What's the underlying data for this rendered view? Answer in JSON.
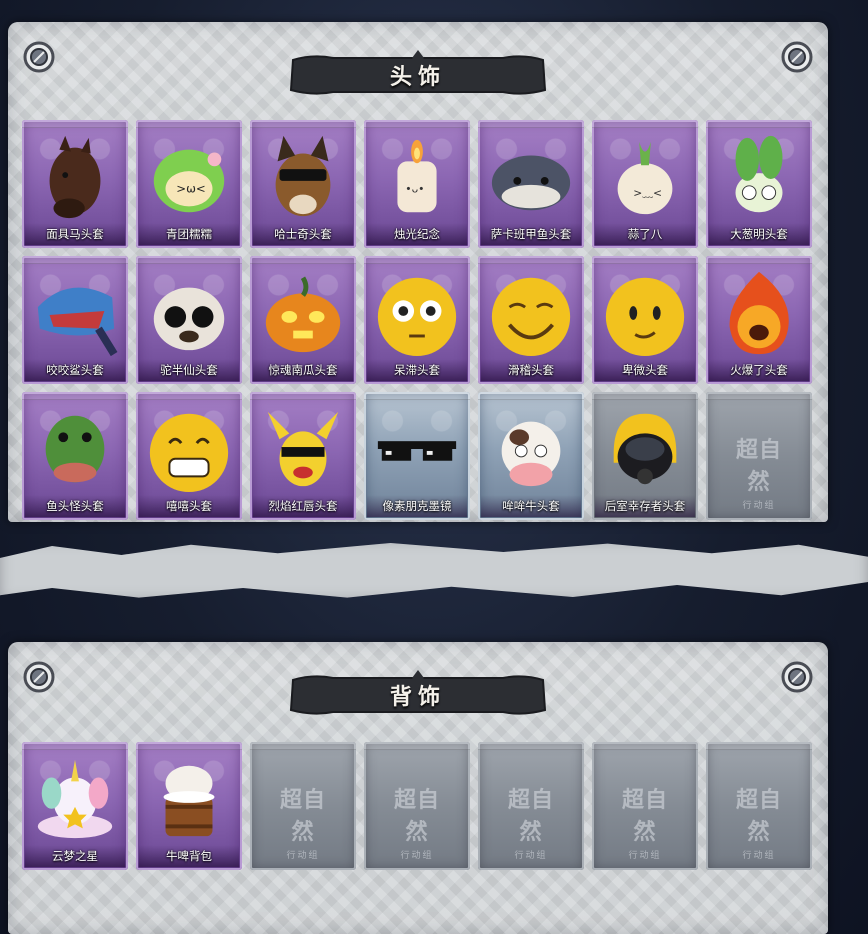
{
  "sections": [
    {
      "title": "头饰",
      "items": [
        {
          "label": "面具马头套",
          "rarity": "purple",
          "icon": "horse-mask-icon"
        },
        {
          "label": "青团糯糯",
          "rarity": "purple",
          "icon": "green-rice-ball-icon"
        },
        {
          "label": "哈士奇头套",
          "rarity": "purple",
          "icon": "husky-sunglasses-icon"
        },
        {
          "label": "烛光纪念",
          "rarity": "purple",
          "icon": "candle-head-icon"
        },
        {
          "label": "萨卡班甲鱼头套",
          "rarity": "purple",
          "icon": "sacabambaspis-fish-icon"
        },
        {
          "label": "蒜了八",
          "rarity": "purple",
          "icon": "garlic-head-icon"
        },
        {
          "label": "大葱明头套",
          "rarity": "purple",
          "icon": "scallion-head-icon"
        },
        {
          "label": "咬咬鲨头套",
          "rarity": "purple",
          "icon": "shark-head-icon"
        },
        {
          "label": "驼半仙头套",
          "rarity": "purple",
          "icon": "alpaca-sunglasses-icon"
        },
        {
          "label": "惊魂南瓜头套",
          "rarity": "purple",
          "icon": "pumpkin-head-icon"
        },
        {
          "label": "呆滞头套",
          "rarity": "purple",
          "icon": "dazed-emoji-icon"
        },
        {
          "label": "滑稽头套",
          "rarity": "purple",
          "icon": "funny-emoji-icon"
        },
        {
          "label": "卑微头套",
          "rarity": "purple",
          "icon": "humble-emoji-icon"
        },
        {
          "label": "火爆了头套",
          "rarity": "purple",
          "icon": "fire-head-icon"
        },
        {
          "label": "鱼头怪头套",
          "rarity": "purple",
          "icon": "fish-monster-icon"
        },
        {
          "label": "嘻嘻头套",
          "rarity": "purple",
          "icon": "grin-emoji-icon"
        },
        {
          "label": "烈焰红唇头套",
          "rarity": "purple",
          "icon": "pikachu-lips-icon"
        },
        {
          "label": "像素朋克墨镜",
          "rarity": "blue",
          "icon": "pixel-sunglasses-icon"
        },
        {
          "label": "哞哞牛头套",
          "rarity": "blue",
          "icon": "cow-head-icon"
        },
        {
          "label": "后室幸存者头套",
          "rarity": "gray",
          "icon": "gas-mask-helmet-icon"
        },
        {
          "label": "",
          "rarity": "empty",
          "icon": "placeholder-logo-icon"
        }
      ]
    },
    {
      "title": "背饰",
      "items": [
        {
          "label": "云梦之星",
          "rarity": "purple",
          "icon": "unicorn-cloud-icon"
        },
        {
          "label": "牛啤背包",
          "rarity": "purple",
          "icon": "cow-beer-barrel-icon"
        },
        {
          "label": "",
          "rarity": "empty",
          "icon": "placeholder-logo-icon"
        },
        {
          "label": "",
          "rarity": "empty",
          "icon": "placeholder-logo-icon"
        },
        {
          "label": "",
          "rarity": "empty",
          "icon": "placeholder-logo-icon"
        },
        {
          "label": "",
          "rarity": "empty",
          "icon": "placeholder-logo-icon"
        },
        {
          "label": "",
          "rarity": "empty",
          "icon": "placeholder-logo-icon"
        }
      ]
    }
  ],
  "placeholder": {
    "big": "超自然",
    "small": "行动组"
  },
  "colors": {
    "purple": "#8c67b3",
    "blue": "#8fa2b6",
    "gray": "#858c95",
    "banner": "#2c2e33"
  }
}
